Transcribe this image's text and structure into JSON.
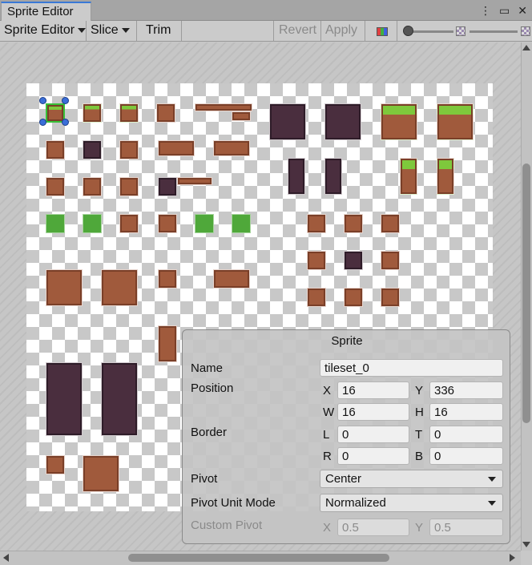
{
  "window": {
    "tab_title": "Sprite Editor",
    "icons": [
      "more-vertical-icon",
      "maximize-icon",
      "close-icon"
    ]
  },
  "toolbar": {
    "mode_dropdown": "Sprite Editor",
    "slice_dropdown": "Slice",
    "trim_label": "Trim",
    "revert_label": "Revert",
    "apply_label": "Apply",
    "channel_icon": "rgb-channel-icon",
    "zoom_icon": "checker-alpha-icon"
  },
  "sprite_panel": {
    "title": "Sprite",
    "name_label": "Name",
    "name_value": "tileset_0",
    "position_label": "Position",
    "x_label": "X",
    "x_value": "16",
    "y_label": "Y",
    "y_value": "336",
    "w_label": "W",
    "w_value": "16",
    "h_label": "H",
    "h_value": "16",
    "border_label": "Border",
    "l_label": "L",
    "l_value": "0",
    "t_label": "T",
    "t_value": "0",
    "r_label": "R",
    "r_value": "0",
    "b_label": "B",
    "b_value": "0",
    "pivot_label": "Pivot",
    "pivot_value": "Center",
    "pivot_unit_label": "Pivot Unit Mode",
    "pivot_unit_value": "Normalized",
    "custom_pivot_label": "Custom Pivot",
    "cx_label": "X",
    "cx_value": "0.5",
    "cy_label": "Y",
    "cy_value": "0.5"
  },
  "colors": {
    "accent": "#3a79d6",
    "dirt": "#a05a3c",
    "grass": "#7ec83c",
    "dark_tile": "#4a2e3e"
  }
}
